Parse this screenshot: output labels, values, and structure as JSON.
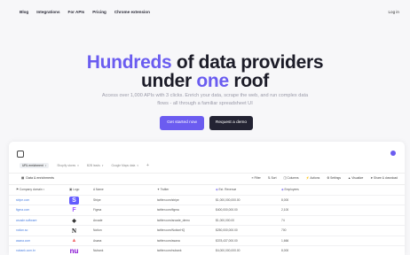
{
  "nav": {
    "links": [
      "Blog",
      "Integrations",
      "For APIs",
      "Pricing",
      "Chrome extension"
    ],
    "login": "Log in"
  },
  "hero": {
    "line1_accent": "Hundreds",
    "line1_rest": " of data providers",
    "line2_start": "under ",
    "line2_accent": "one",
    "line2_end": " roof",
    "subtitle": "Access over 1,000 APIs with 3 clicks. Enrich your data, scrape the web, and run complex data flows - all through a familiar spreadsheet UI",
    "cta_primary": "Get started now",
    "cta_secondary": "Request a demo"
  },
  "app": {
    "tabs": [
      {
        "label": "URL enrichment"
      },
      {
        "label": "Shopify stores"
      },
      {
        "label": "B2B leads"
      },
      {
        "label": "Google Maps data"
      }
    ],
    "add_tab": "+",
    "table_name": "Data & enrichments",
    "toolbar": [
      "Filter",
      "Sort",
      "Columns",
      "Actions",
      "Settings",
      "Visualize",
      "Share & download"
    ],
    "columns": [
      "Company domain",
      "Logo",
      "Name",
      "Twitter",
      "Est. Revenue",
      "Employees"
    ],
    "rows": [
      {
        "domain": "stripe.com",
        "logo": "S",
        "name": "Stripe",
        "twitter": "twitter.com/stripe",
        "revenue": "$1,000,000,000.00",
        "employees": "8,000"
      },
      {
        "domain": "figma.com",
        "logo": "F",
        "name": "Figma",
        "twitter": "twitter.com/figma",
        "revenue": "$400,000,000.00",
        "employees": "2,100"
      },
      {
        "domain": "arcade.software",
        "logo": "◆",
        "name": "Arcade",
        "twitter": "twitter.com/arcade_demo",
        "revenue": "$1,000,000.00",
        "employees": "74"
      },
      {
        "domain": "notion.so",
        "logo": "N",
        "name": "Notion",
        "twitter": "twitter.com/NotionHQ",
        "revenue": "$250,000,000.00",
        "employees": "700"
      },
      {
        "domain": "asana.com",
        "logo": "▲",
        "name": "Asana",
        "twitter": "twitter.com/asana",
        "revenue": "$378,437,000.00",
        "employees": "1,666"
      },
      {
        "domain": "nubank.com.br",
        "logo": "nu",
        "name": "Nubank",
        "twitter": "twitter.com/nubank",
        "revenue": "$4,000,000,000.00",
        "employees": "8,000"
      }
    ]
  },
  "colors": {
    "accent": "#6b5cf0",
    "dark_button": "#232333",
    "link": "#4a7fe0",
    "stripe": "#635bff",
    "nubank": "#820ad1",
    "asana": "#f06a6a"
  }
}
